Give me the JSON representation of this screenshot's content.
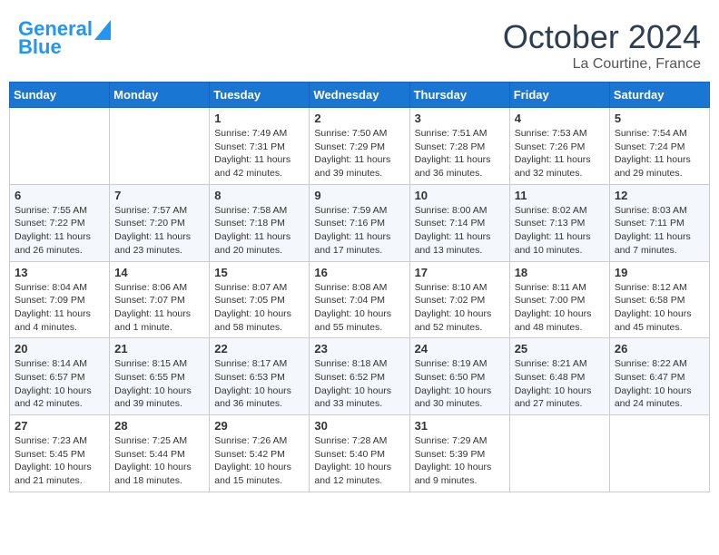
{
  "header": {
    "logo_line1": "General",
    "logo_line2": "Blue",
    "month": "October 2024",
    "location": "La Courtine, France"
  },
  "days_of_week": [
    "Sunday",
    "Monday",
    "Tuesday",
    "Wednesday",
    "Thursday",
    "Friday",
    "Saturday"
  ],
  "weeks": [
    [
      {
        "day": "",
        "sunrise": "",
        "sunset": "",
        "daylight": ""
      },
      {
        "day": "",
        "sunrise": "",
        "sunset": "",
        "daylight": ""
      },
      {
        "day": "1",
        "sunrise": "Sunrise: 7:49 AM",
        "sunset": "Sunset: 7:31 PM",
        "daylight": "Daylight: 11 hours and 42 minutes."
      },
      {
        "day": "2",
        "sunrise": "Sunrise: 7:50 AM",
        "sunset": "Sunset: 7:29 PM",
        "daylight": "Daylight: 11 hours and 39 minutes."
      },
      {
        "day": "3",
        "sunrise": "Sunrise: 7:51 AM",
        "sunset": "Sunset: 7:28 PM",
        "daylight": "Daylight: 11 hours and 36 minutes."
      },
      {
        "day": "4",
        "sunrise": "Sunrise: 7:53 AM",
        "sunset": "Sunset: 7:26 PM",
        "daylight": "Daylight: 11 hours and 32 minutes."
      },
      {
        "day": "5",
        "sunrise": "Sunrise: 7:54 AM",
        "sunset": "Sunset: 7:24 PM",
        "daylight": "Daylight: 11 hours and 29 minutes."
      }
    ],
    [
      {
        "day": "6",
        "sunrise": "Sunrise: 7:55 AM",
        "sunset": "Sunset: 7:22 PM",
        "daylight": "Daylight: 11 hours and 26 minutes."
      },
      {
        "day": "7",
        "sunrise": "Sunrise: 7:57 AM",
        "sunset": "Sunset: 7:20 PM",
        "daylight": "Daylight: 11 hours and 23 minutes."
      },
      {
        "day": "8",
        "sunrise": "Sunrise: 7:58 AM",
        "sunset": "Sunset: 7:18 PM",
        "daylight": "Daylight: 11 hours and 20 minutes."
      },
      {
        "day": "9",
        "sunrise": "Sunrise: 7:59 AM",
        "sunset": "Sunset: 7:16 PM",
        "daylight": "Daylight: 11 hours and 17 minutes."
      },
      {
        "day": "10",
        "sunrise": "Sunrise: 8:00 AM",
        "sunset": "Sunset: 7:14 PM",
        "daylight": "Daylight: 11 hours and 13 minutes."
      },
      {
        "day": "11",
        "sunrise": "Sunrise: 8:02 AM",
        "sunset": "Sunset: 7:13 PM",
        "daylight": "Daylight: 11 hours and 10 minutes."
      },
      {
        "day": "12",
        "sunrise": "Sunrise: 8:03 AM",
        "sunset": "Sunset: 7:11 PM",
        "daylight": "Daylight: 11 hours and 7 minutes."
      }
    ],
    [
      {
        "day": "13",
        "sunrise": "Sunrise: 8:04 AM",
        "sunset": "Sunset: 7:09 PM",
        "daylight": "Daylight: 11 hours and 4 minutes."
      },
      {
        "day": "14",
        "sunrise": "Sunrise: 8:06 AM",
        "sunset": "Sunset: 7:07 PM",
        "daylight": "Daylight: 11 hours and 1 minute."
      },
      {
        "day": "15",
        "sunrise": "Sunrise: 8:07 AM",
        "sunset": "Sunset: 7:05 PM",
        "daylight": "Daylight: 10 hours and 58 minutes."
      },
      {
        "day": "16",
        "sunrise": "Sunrise: 8:08 AM",
        "sunset": "Sunset: 7:04 PM",
        "daylight": "Daylight: 10 hours and 55 minutes."
      },
      {
        "day": "17",
        "sunrise": "Sunrise: 8:10 AM",
        "sunset": "Sunset: 7:02 PM",
        "daylight": "Daylight: 10 hours and 52 minutes."
      },
      {
        "day": "18",
        "sunrise": "Sunrise: 8:11 AM",
        "sunset": "Sunset: 7:00 PM",
        "daylight": "Daylight: 10 hours and 48 minutes."
      },
      {
        "day": "19",
        "sunrise": "Sunrise: 8:12 AM",
        "sunset": "Sunset: 6:58 PM",
        "daylight": "Daylight: 10 hours and 45 minutes."
      }
    ],
    [
      {
        "day": "20",
        "sunrise": "Sunrise: 8:14 AM",
        "sunset": "Sunset: 6:57 PM",
        "daylight": "Daylight: 10 hours and 42 minutes."
      },
      {
        "day": "21",
        "sunrise": "Sunrise: 8:15 AM",
        "sunset": "Sunset: 6:55 PM",
        "daylight": "Daylight: 10 hours and 39 minutes."
      },
      {
        "day": "22",
        "sunrise": "Sunrise: 8:17 AM",
        "sunset": "Sunset: 6:53 PM",
        "daylight": "Daylight: 10 hours and 36 minutes."
      },
      {
        "day": "23",
        "sunrise": "Sunrise: 8:18 AM",
        "sunset": "Sunset: 6:52 PM",
        "daylight": "Daylight: 10 hours and 33 minutes."
      },
      {
        "day": "24",
        "sunrise": "Sunrise: 8:19 AM",
        "sunset": "Sunset: 6:50 PM",
        "daylight": "Daylight: 10 hours and 30 minutes."
      },
      {
        "day": "25",
        "sunrise": "Sunrise: 8:21 AM",
        "sunset": "Sunset: 6:48 PM",
        "daylight": "Daylight: 10 hours and 27 minutes."
      },
      {
        "day": "26",
        "sunrise": "Sunrise: 8:22 AM",
        "sunset": "Sunset: 6:47 PM",
        "daylight": "Daylight: 10 hours and 24 minutes."
      }
    ],
    [
      {
        "day": "27",
        "sunrise": "Sunrise: 7:23 AM",
        "sunset": "Sunset: 5:45 PM",
        "daylight": "Daylight: 10 hours and 21 minutes."
      },
      {
        "day": "28",
        "sunrise": "Sunrise: 7:25 AM",
        "sunset": "Sunset: 5:44 PM",
        "daylight": "Daylight: 10 hours and 18 minutes."
      },
      {
        "day": "29",
        "sunrise": "Sunrise: 7:26 AM",
        "sunset": "Sunset: 5:42 PM",
        "daylight": "Daylight: 10 hours and 15 minutes."
      },
      {
        "day": "30",
        "sunrise": "Sunrise: 7:28 AM",
        "sunset": "Sunset: 5:40 PM",
        "daylight": "Daylight: 10 hours and 12 minutes."
      },
      {
        "day": "31",
        "sunrise": "Sunrise: 7:29 AM",
        "sunset": "Sunset: 5:39 PM",
        "daylight": "Daylight: 10 hours and 9 minutes."
      },
      {
        "day": "",
        "sunrise": "",
        "sunset": "",
        "daylight": ""
      },
      {
        "day": "",
        "sunrise": "",
        "sunset": "",
        "daylight": ""
      }
    ]
  ]
}
